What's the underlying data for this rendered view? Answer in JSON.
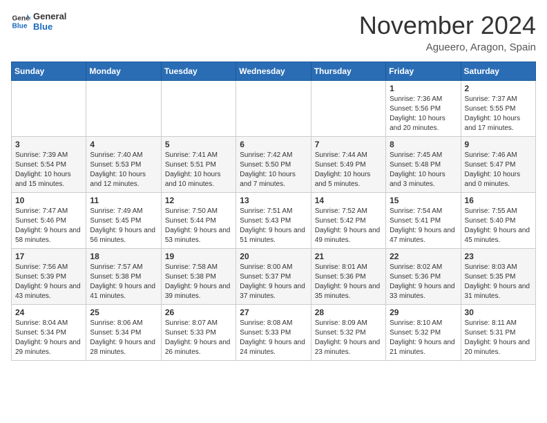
{
  "header": {
    "logo_general": "General",
    "logo_blue": "Blue",
    "month_title": "November 2024",
    "location": "Agueero, Aragon, Spain"
  },
  "days_of_week": [
    "Sunday",
    "Monday",
    "Tuesday",
    "Wednesday",
    "Thursday",
    "Friday",
    "Saturday"
  ],
  "weeks": [
    [
      {
        "day": "",
        "info": ""
      },
      {
        "day": "",
        "info": ""
      },
      {
        "day": "",
        "info": ""
      },
      {
        "day": "",
        "info": ""
      },
      {
        "day": "",
        "info": ""
      },
      {
        "day": "1",
        "info": "Sunrise: 7:36 AM\nSunset: 5:56 PM\nDaylight: 10 hours and 20 minutes."
      },
      {
        "day": "2",
        "info": "Sunrise: 7:37 AM\nSunset: 5:55 PM\nDaylight: 10 hours and 17 minutes."
      }
    ],
    [
      {
        "day": "3",
        "info": "Sunrise: 7:39 AM\nSunset: 5:54 PM\nDaylight: 10 hours and 15 minutes."
      },
      {
        "day": "4",
        "info": "Sunrise: 7:40 AM\nSunset: 5:53 PM\nDaylight: 10 hours and 12 minutes."
      },
      {
        "day": "5",
        "info": "Sunrise: 7:41 AM\nSunset: 5:51 PM\nDaylight: 10 hours and 10 minutes."
      },
      {
        "day": "6",
        "info": "Sunrise: 7:42 AM\nSunset: 5:50 PM\nDaylight: 10 hours and 7 minutes."
      },
      {
        "day": "7",
        "info": "Sunrise: 7:44 AM\nSunset: 5:49 PM\nDaylight: 10 hours and 5 minutes."
      },
      {
        "day": "8",
        "info": "Sunrise: 7:45 AM\nSunset: 5:48 PM\nDaylight: 10 hours and 3 minutes."
      },
      {
        "day": "9",
        "info": "Sunrise: 7:46 AM\nSunset: 5:47 PM\nDaylight: 10 hours and 0 minutes."
      }
    ],
    [
      {
        "day": "10",
        "info": "Sunrise: 7:47 AM\nSunset: 5:46 PM\nDaylight: 9 hours and 58 minutes."
      },
      {
        "day": "11",
        "info": "Sunrise: 7:49 AM\nSunset: 5:45 PM\nDaylight: 9 hours and 56 minutes."
      },
      {
        "day": "12",
        "info": "Sunrise: 7:50 AM\nSunset: 5:44 PM\nDaylight: 9 hours and 53 minutes."
      },
      {
        "day": "13",
        "info": "Sunrise: 7:51 AM\nSunset: 5:43 PM\nDaylight: 9 hours and 51 minutes."
      },
      {
        "day": "14",
        "info": "Sunrise: 7:52 AM\nSunset: 5:42 PM\nDaylight: 9 hours and 49 minutes."
      },
      {
        "day": "15",
        "info": "Sunrise: 7:54 AM\nSunset: 5:41 PM\nDaylight: 9 hours and 47 minutes."
      },
      {
        "day": "16",
        "info": "Sunrise: 7:55 AM\nSunset: 5:40 PM\nDaylight: 9 hours and 45 minutes."
      }
    ],
    [
      {
        "day": "17",
        "info": "Sunrise: 7:56 AM\nSunset: 5:39 PM\nDaylight: 9 hours and 43 minutes."
      },
      {
        "day": "18",
        "info": "Sunrise: 7:57 AM\nSunset: 5:38 PM\nDaylight: 9 hours and 41 minutes."
      },
      {
        "day": "19",
        "info": "Sunrise: 7:58 AM\nSunset: 5:38 PM\nDaylight: 9 hours and 39 minutes."
      },
      {
        "day": "20",
        "info": "Sunrise: 8:00 AM\nSunset: 5:37 PM\nDaylight: 9 hours and 37 minutes."
      },
      {
        "day": "21",
        "info": "Sunrise: 8:01 AM\nSunset: 5:36 PM\nDaylight: 9 hours and 35 minutes."
      },
      {
        "day": "22",
        "info": "Sunrise: 8:02 AM\nSunset: 5:36 PM\nDaylight: 9 hours and 33 minutes."
      },
      {
        "day": "23",
        "info": "Sunrise: 8:03 AM\nSunset: 5:35 PM\nDaylight: 9 hours and 31 minutes."
      }
    ],
    [
      {
        "day": "24",
        "info": "Sunrise: 8:04 AM\nSunset: 5:34 PM\nDaylight: 9 hours and 29 minutes."
      },
      {
        "day": "25",
        "info": "Sunrise: 8:06 AM\nSunset: 5:34 PM\nDaylight: 9 hours and 28 minutes."
      },
      {
        "day": "26",
        "info": "Sunrise: 8:07 AM\nSunset: 5:33 PM\nDaylight: 9 hours and 26 minutes."
      },
      {
        "day": "27",
        "info": "Sunrise: 8:08 AM\nSunset: 5:33 PM\nDaylight: 9 hours and 24 minutes."
      },
      {
        "day": "28",
        "info": "Sunrise: 8:09 AM\nSunset: 5:32 PM\nDaylight: 9 hours and 23 minutes."
      },
      {
        "day": "29",
        "info": "Sunrise: 8:10 AM\nSunset: 5:32 PM\nDaylight: 9 hours and 21 minutes."
      },
      {
        "day": "30",
        "info": "Sunrise: 8:11 AM\nSunset: 5:31 PM\nDaylight: 9 hours and 20 minutes."
      }
    ]
  ]
}
